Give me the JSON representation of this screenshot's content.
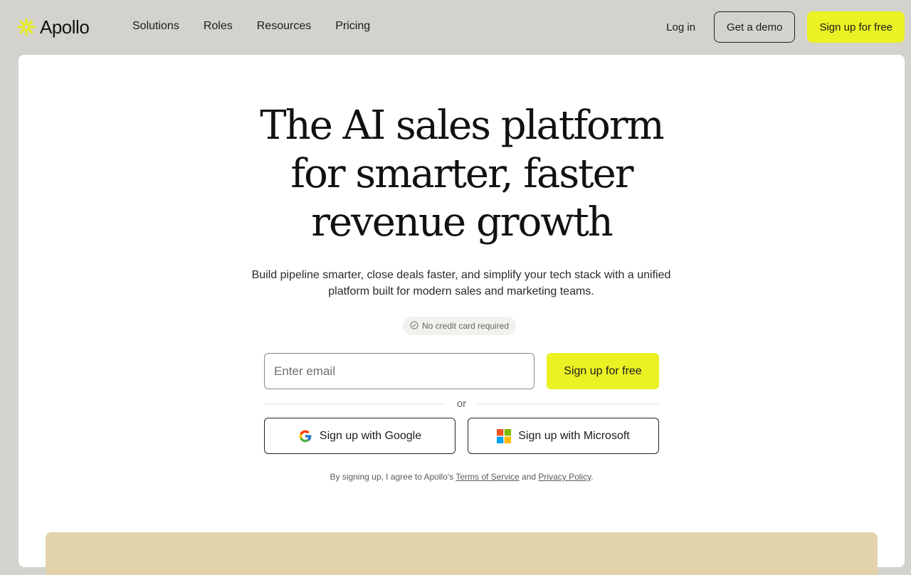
{
  "header": {
    "brand": "Apollo",
    "nav": [
      "Solutions",
      "Roles",
      "Resources",
      "Pricing"
    ],
    "login_label": "Log in",
    "demo_label": "Get a demo",
    "signup_label": "Sign up for free"
  },
  "hero": {
    "headline_lines": [
      "The AI sales platform",
      "for smarter, faster",
      "revenue growth"
    ],
    "subtext": "Build pipeline smarter, close deals faster, and simplify your tech stack with a unified platform built for modern sales and marketing teams.",
    "badge": "No credit card required"
  },
  "form": {
    "email_placeholder": "Enter email",
    "signup_label": "Sign up for free",
    "or_label": "or",
    "google_label": "Sign up with Google",
    "microsoft_label": "Sign up with Microsoft"
  },
  "legal": {
    "prefix": "By signing up, I agree to Apollo's",
    "tos": "Terms of Service",
    "and": "and",
    "privacy": "Privacy Policy",
    "suffix": "."
  },
  "colors": {
    "accent": "#ebf224",
    "page_bg": "#d4d2cd",
    "card_bg": "#ffffff",
    "bottom_panel": "#e3d3ab"
  },
  "icons": [
    "apollo-logo-icon",
    "check-circle-icon",
    "google-icon",
    "microsoft-icon"
  ]
}
